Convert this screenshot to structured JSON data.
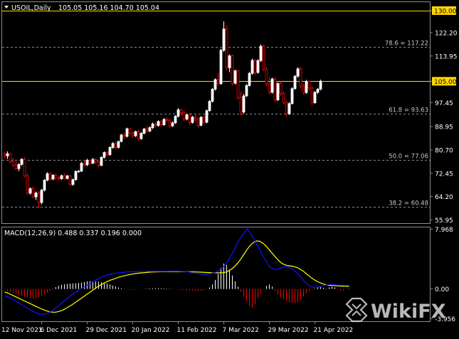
{
  "chart_data": [
    {
      "type": "candlestick",
      "panel": "main",
      "symbol_header": "USOIL,Daily",
      "ohlc_header": "105.05 105.16 104.70 105.04",
      "colors": {
        "background": "#000000",
        "up": "#ffffff",
        "down": "#ff0000",
        "level_line": "#ffd700",
        "grid": "#8c8c8c",
        "axis_text": "#ffffff",
        "current_price_box": "#ffd700"
      },
      "y_ticks": [
        130.0,
        122.2,
        113.95,
        105.0,
        97.45,
        88.95,
        80.7,
        72.45,
        64.2,
        55.95
      ],
      "ylim": [
        54.8,
        133.0
      ],
      "horizontal_levels": [
        {
          "value": 130.0,
          "label": "130.00",
          "style": "solid"
        },
        {
          "value": 105.0,
          "label": "105.00",
          "style": "solid"
        }
      ],
      "fibonacci_levels": [
        {
          "value": 117.22,
          "label": "78.6 = 117.22"
        },
        {
          "value": 93.63,
          "label": "61.8 = 93.63"
        },
        {
          "value": 77.06,
          "label": "50.0 = 77.06"
        },
        {
          "value": 60.48,
          "label": "38.2 = 60.48"
        }
      ],
      "candles": [
        [
          79.2,
          80.0,
          77.8,
          78.6
        ],
        [
          78.6,
          80.2,
          77.5,
          79.4
        ],
        [
          79.4,
          79.8,
          76.0,
          76.6
        ],
        [
          76.6,
          78.0,
          74.8,
          75.3
        ],
        [
          75.3,
          76.5,
          73.6,
          74.1
        ],
        [
          74.1,
          76.0,
          73.2,
          75.6
        ],
        [
          75.6,
          77.8,
          75.1,
          77.4
        ],
        [
          77.4,
          78.2,
          71.0,
          71.6
        ],
        [
          71.6,
          72.4,
          64.8,
          65.4
        ],
        [
          65.4,
          67.5,
          64.9,
          67.0
        ],
        [
          67.0,
          67.8,
          63.6,
          64.1
        ],
        [
          64.1,
          66.0,
          63.0,
          65.5
        ],
        [
          65.5,
          66.3,
          60.2,
          62.1
        ],
        [
          62.1,
          66.9,
          61.5,
          66.5
        ],
        [
          66.5,
          70.4,
          66.0,
          70.0
        ],
        [
          70.0,
          72.8,
          69.6,
          72.3
        ],
        [
          72.3,
          72.9,
          69.8,
          70.4
        ],
        [
          70.4,
          72.1,
          70.0,
          71.8
        ],
        [
          71.8,
          72.2,
          70.2,
          70.9
        ],
        [
          70.9,
          71.6,
          70.0,
          70.5
        ],
        [
          70.5,
          72.0,
          70.1,
          71.6
        ],
        [
          71.6,
          72.5,
          70.2,
          70.6
        ],
        [
          70.6,
          71.9,
          70.3,
          71.5
        ],
        [
          71.5,
          71.9,
          67.8,
          68.5
        ],
        [
          68.5,
          70.5,
          68.0,
          70.2
        ],
        [
          70.2,
          73.5,
          69.8,
          73.1
        ],
        [
          73.1,
          73.6,
          72.6,
          73.2
        ],
        [
          73.2,
          76.5,
          72.9,
          76.0
        ],
        [
          76.0,
          76.7,
          74.8,
          75.4
        ],
        [
          75.4,
          77.6,
          75.0,
          77.1
        ],
        [
          77.1,
          77.3,
          75.5,
          76.0
        ],
        [
          76.0,
          77.9,
          75.7,
          77.3
        ],
        [
          77.3,
          77.8,
          75.6,
          76.5
        ],
        [
          76.5,
          76.9,
          74.6,
          75.2
        ],
        [
          75.2,
          78.4,
          75.0,
          78.1
        ],
        [
          78.1,
          80.2,
          77.6,
          79.8
        ],
        [
          79.8,
          80.3,
          78.5,
          79.0
        ],
        [
          79.0,
          82.0,
          78.7,
          81.6
        ],
        [
          81.6,
          83.5,
          81.1,
          83.0
        ],
        [
          83.0,
          83.6,
          80.9,
          81.6
        ],
        [
          81.6,
          84.0,
          81.2,
          83.7
        ],
        [
          83.7,
          86.4,
          83.4,
          86.0
        ],
        [
          86.0,
          86.8,
          84.6,
          85.5
        ],
        [
          85.5,
          88.6,
          85.1,
          88.2
        ],
        [
          88.2,
          88.5,
          86.0,
          86.7
        ],
        [
          86.7,
          87.3,
          85.1,
          85.7
        ],
        [
          85.7,
          87.5,
          85.3,
          87.2
        ],
        [
          87.2,
          87.8,
          83.9,
          84.7
        ],
        [
          84.7,
          87.0,
          84.3,
          86.6
        ],
        [
          86.6,
          88.5,
          86.2,
          88.1
        ],
        [
          88.1,
          89.2,
          86.9,
          87.4
        ],
        [
          87.4,
          89.0,
          87.0,
          88.6
        ],
        [
          88.6,
          90.4,
          88.1,
          89.9
        ],
        [
          89.9,
          90.5,
          88.7,
          89.3
        ],
        [
          89.3,
          91.2,
          89.0,
          90.8
        ],
        [
          90.8,
          91.2,
          89.1,
          89.6
        ],
        [
          89.6,
          92.0,
          89.2,
          91.5
        ],
        [
          91.5,
          92.3,
          90.7,
          91.2
        ],
        [
          91.2,
          91.6,
          88.4,
          89.2
        ],
        [
          89.2,
          90.7,
          88.8,
          90.3
        ],
        [
          90.3,
          93.0,
          89.9,
          92.6
        ],
        [
          92.6,
          95.5,
          92.2,
          94.9
        ],
        [
          94.9,
          95.3,
          93.2,
          93.9
        ],
        [
          93.9,
          94.8,
          91.0,
          91.6
        ],
        [
          91.6,
          93.5,
          91.2,
          93.1
        ],
        [
          93.1,
          93.8,
          89.6,
          90.4
        ],
        [
          90.4,
          92.8,
          90.0,
          92.3
        ],
        [
          92.3,
          93.4,
          90.8,
          91.7
        ],
        [
          91.7,
          92.0,
          88.6,
          89.4
        ],
        [
          89.4,
          92.6,
          89.1,
          92.3
        ],
        [
          92.3,
          92.8,
          89.8,
          90.5
        ],
        [
          90.5,
          95.0,
          90.1,
          94.6
        ],
        [
          94.6,
          98.3,
          94.2,
          97.9
        ],
        [
          97.9,
          102.6,
          97.5,
          102.2
        ],
        [
          102.2,
          106.0,
          101.7,
          105.6
        ],
        [
          105.6,
          108.0,
          103.5,
          104.1
        ],
        [
          104.1,
          116.5,
          103.8,
          116.0
        ],
        [
          116.0,
          126.2,
          115.4,
          123.5
        ],
        [
          123.5,
          124.8,
          109.0,
          109.8
        ],
        [
          109.8,
          114.5,
          108.2,
          114.0
        ],
        [
          114.0,
          114.4,
          103.5,
          104.3
        ],
        [
          104.3,
          109.1,
          103.9,
          108.7
        ],
        [
          108.7,
          109.0,
          98.5,
          99.3
        ],
        [
          99.3,
          101.4,
          93.0,
          94.1
        ],
        [
          94.1,
          100.5,
          93.6,
          99.8
        ],
        [
          99.8,
          104.0,
          99.5,
          103.5
        ],
        [
          103.5,
          108.4,
          103.1,
          107.8
        ],
        [
          107.8,
          113.0,
          107.3,
          112.4
        ],
        [
          112.4,
          112.8,
          107.2,
          108.1
        ],
        [
          108.1,
          112.8,
          107.7,
          112.3
        ],
        [
          112.3,
          118.0,
          111.8,
          117.4
        ],
        [
          117.4,
          118.0,
          108.5,
          109.2
        ],
        [
          109.2,
          110.0,
          103.1,
          104.0
        ],
        [
          104.0,
          106.5,
          100.3,
          101.1
        ],
        [
          101.1,
          106.3,
          100.6,
          105.8
        ],
        [
          105.8,
          106.4,
          97.5,
          98.4
        ],
        [
          98.4,
          104.6,
          98.0,
          104.2
        ],
        [
          104.2,
          104.9,
          99.9,
          100.7
        ],
        [
          100.7,
          101.3,
          96.9,
          97.5
        ],
        [
          97.5,
          98.0,
          92.6,
          93.5
        ],
        [
          93.5,
          97.6,
          93.1,
          97.1
        ],
        [
          97.1,
          102.9,
          96.8,
          102.4
        ],
        [
          102.4,
          107.2,
          102.0,
          106.8
        ],
        [
          106.8,
          110.0,
          106.3,
          109.4
        ],
        [
          109.4,
          110.1,
          102.5,
          103.3
        ],
        [
          103.3,
          104.0,
          100.2,
          101.0
        ],
        [
          101.0,
          105.5,
          100.6,
          105.0
        ],
        [
          105.0,
          105.3,
          101.8,
          102.6
        ],
        [
          102.6,
          103.0,
          96.5,
          97.4
        ],
        [
          97.4,
          101.5,
          97.0,
          101.1
        ],
        [
          101.1,
          102.6,
          100.5,
          102.2
        ],
        [
          102.2,
          105.6,
          101.8,
          105.04
        ]
      ],
      "x_ticks": [
        {
          "index": -2,
          "label": "12 Nov 2021"
        },
        {
          "index": 13,
          "label": "6 Dec 2021"
        },
        {
          "index": 29,
          "label": "29 Dec 2021"
        },
        {
          "index": 45,
          "label": "20 Jan 2022"
        },
        {
          "index": 61,
          "label": "11 Feb 2022"
        },
        {
          "index": 77,
          "label": "7 Mar 2022"
        },
        {
          "index": 93,
          "label": "29 Mar 2022"
        },
        {
          "index": 109,
          "label": "21 Apr 2022"
        }
      ]
    },
    {
      "type": "macd",
      "panel": "indicator",
      "header": "MACD(12,26,9) 0.488 0.337 0.196 0.000",
      "y_ticks": [
        7.968,
        0.0,
        -3.956
      ],
      "ylim": [
        -4.3,
        8.2
      ],
      "colors": {
        "histogram_positive": "#ffffff",
        "histogram_negative": "#ff0000",
        "macd_line": "#1414ff",
        "signal_line": "#ffff00"
      },
      "histogram": [
        -0.12,
        -0.25,
        -0.38,
        -0.52,
        -0.65,
        -0.78,
        -0.9,
        -1.0,
        -1.1,
        -1.2,
        -1.28,
        -1.22,
        -1.1,
        -0.92,
        -0.7,
        -0.45,
        -0.2,
        0.05,
        0.25,
        0.42,
        0.55,
        0.62,
        0.68,
        0.72,
        0.74,
        0.76,
        0.8,
        0.85,
        0.92,
        1.0,
        1.05,
        1.02,
        1.0,
        0.95,
        0.9,
        0.82,
        0.72,
        0.6,
        0.45,
        0.32,
        0.2,
        0.1,
        0.02,
        -0.05,
        -0.1,
        -0.12,
        -0.1,
        -0.06,
        -0.02,
        0.02,
        0.05,
        0.08,
        0.1,
        0.12,
        0.12,
        0.1,
        0.08,
        0.06,
        0.04,
        0.02,
        0.0,
        -0.05,
        -0.12,
        -0.15,
        -0.2,
        -0.22,
        -0.24,
        -0.28,
        -0.3,
        -0.25,
        -0.15,
        -0.05,
        0.2,
        0.6,
        1.2,
        2.0,
        2.8,
        3.4,
        3.2,
        2.6,
        1.8,
        1.0,
        0.3,
        -0.4,
        -1.0,
        -1.6,
        -2.2,
        -2.5,
        -2.0,
        -1.2,
        -0.6,
        -0.1,
        0.4,
        0.6,
        0.3,
        -0.2,
        -0.7,
        -1.1,
        -1.4,
        -1.6,
        -1.75,
        -1.85,
        -1.9,
        -1.8,
        -1.5,
        -1.0,
        -0.6,
        -0.3,
        -0.1,
        0.05,
        0.2,
        0.25,
        0.15,
        0.05,
        0.196,
        0.3,
        0.2,
        -0.1,
        -0.3,
        -0.2,
        -0.05,
        0.05
      ],
      "macd_line": [
        -0.9,
        -1.05,
        -1.25,
        -1.5,
        -1.75,
        -2.0,
        -2.25,
        -2.5,
        -2.75,
        -3.0,
        -3.2,
        -3.35,
        -3.4,
        -3.3,
        -3.1,
        -2.85,
        -2.55,
        -2.2,
        -1.85,
        -1.5,
        -1.15,
        -0.8,
        -0.5,
        -0.2,
        0.05,
        0.3,
        0.55,
        0.8,
        1.05,
        1.3,
        1.5,
        1.7,
        1.85,
        1.95,
        2.05,
        2.1,
        2.15,
        2.2,
        2.25,
        2.28,
        2.3,
        2.32,
        2.33,
        2.34,
        2.35,
        2.35,
        2.35,
        2.35,
        2.34,
        2.34,
        2.35,
        2.35,
        2.36,
        2.36,
        2.36,
        2.35,
        2.33,
        2.3,
        2.25,
        2.15,
        2.05,
        2.0,
        1.95,
        1.95,
        2.0,
        2.1,
        2.2,
        2.4,
        2.7,
        3.1,
        3.7,
        4.4,
        5.2,
        6.1,
        6.8,
        7.4,
        7.968,
        7.5,
        6.8,
        6.0,
        5.2,
        4.4,
        3.7,
        3.0,
        2.7,
        2.6,
        2.7,
        2.9,
        3.0,
        2.9,
        2.7,
        2.4,
        2.0,
        1.5,
        1.0,
        0.6,
        0.3,
        0.2,
        0.25,
        0.35,
        0.45,
        0.55,
        0.6,
        0.6,
        0.55,
        0.5,
        0.5,
        0.5,
        0.488
      ],
      "signal_line": [
        -0.4,
        -0.55,
        -0.75,
        -0.95,
        -1.15,
        -1.35,
        -1.55,
        -1.75,
        -1.95,
        -2.15,
        -2.35,
        -2.55,
        -2.75,
        -2.9,
        -3.02,
        -3.1,
        -3.1,
        -3.0,
        -2.85,
        -2.65,
        -2.4,
        -2.15,
        -1.85,
        -1.55,
        -1.25,
        -0.95,
        -0.65,
        -0.35,
        -0.05,
        0.25,
        0.5,
        0.75,
        0.95,
        1.15,
        1.3,
        1.45,
        1.6,
        1.7,
        1.8,
        1.9,
        1.98,
        2.05,
        2.1,
        2.15,
        2.18,
        2.22,
        2.25,
        2.27,
        2.28,
        2.29,
        2.3,
        2.3,
        2.3,
        2.3,
        2.3,
        2.3,
        2.3,
        2.3,
        2.29,
        2.28,
        2.26,
        2.24,
        2.22,
        2.2,
        2.18,
        2.16,
        2.15,
        2.15,
        2.16,
        2.2,
        2.35,
        2.6,
        2.95,
        3.4,
        3.95,
        4.6,
        5.25,
        5.8,
        6.2,
        6.4,
        6.35,
        6.1,
        5.7,
        5.2,
        4.7,
        4.2,
        3.75,
        3.4,
        3.2,
        3.1,
        3.05,
        2.95,
        2.8,
        2.55,
        2.25,
        1.9,
        1.55,
        1.25,
        1.0,
        0.8,
        0.65,
        0.55,
        0.48,
        0.45,
        0.42,
        0.4,
        0.38,
        0.36,
        0.337
      ]
    }
  ],
  "watermark": "WikiFX"
}
